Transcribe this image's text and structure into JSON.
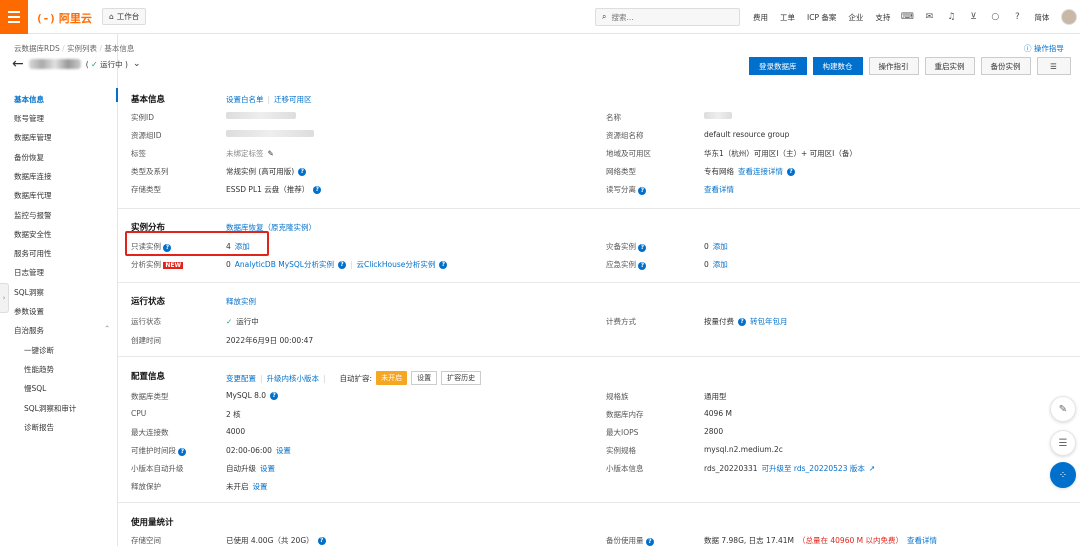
{
  "topbar": {
    "logo_mark": "(-)",
    "logo_text": "阿里云",
    "workbench": "工作台",
    "search_placeholder": "搜索...",
    "nav": [
      "费用",
      "工单",
      "ICP 备案",
      "企业",
      "支持"
    ],
    "lang": "简体"
  },
  "sidebar": {
    "items": [
      "基本信息",
      "账号管理",
      "数据库管理",
      "备份恢复",
      "数据库连接",
      "数据库代理",
      "监控与报警",
      "数据安全性",
      "服务可用性",
      "日志管理",
      "SQL洞察",
      "参数设置",
      "自治服务",
      "一键诊断",
      "性能趋势",
      "慢SQL",
      "SQL洞察和审计",
      "诊断报告"
    ]
  },
  "header": {
    "breadcrumb": [
      "云数据库RDS",
      "实例列表",
      "基本信息"
    ],
    "status": "运行中",
    "help": "操作指导"
  },
  "actions": {
    "login": "登录数据库",
    "build": "构建数仓",
    "guide": "操作指引",
    "restart": "重启实例",
    "backup": "备份实例"
  },
  "basic": {
    "title": "基本信息",
    "link_whitelist": "设置白名单",
    "link_migrate": "迁移可用区",
    "instance_id_label": "实例ID",
    "name_label": "名称",
    "rg_id_label": "资源组ID",
    "rg_name_label": "资源组名称",
    "rg_name_value": "default resource group",
    "tag_label": "标签",
    "tag_value": "未绑定标签",
    "region_label": "地域及可用区",
    "region_value": "华东1（杭州）可用区I（主）+ 可用区I（备）",
    "type_label": "类型及系列",
    "type_value": "常规实例 (高可用版)",
    "network_label": "网络类型",
    "network_value": "专有网络",
    "network_link": "查看连接详情",
    "storage_label": "存储类型",
    "storage_value": "ESSD PL1 云盘（推荐）",
    "rw_label": "读写分离",
    "rw_link": "查看详情"
  },
  "dist": {
    "title": "实例分布",
    "link": "数据库恢复（原克隆实例）",
    "ro_label": "只读实例",
    "ro_value": "4",
    "ro_add": "添加",
    "dr_label": "灾备实例",
    "dr_value": "0",
    "dr_add": "添加",
    "an_label": "分析实例",
    "an_tag": "NEW",
    "an_value": "0",
    "an_link1": "AnalyticDB MySQL分析实例",
    "an_link2": "云ClickHouse分析实例",
    "em_label": "应急实例",
    "em_value": "0",
    "em_add": "添加"
  },
  "run": {
    "title": "运行状态",
    "link": "释放实例",
    "status_label": "运行状态",
    "status_value": "运行中",
    "pay_label": "计费方式",
    "pay_value": "按量付费",
    "pay_link": "转包年包月",
    "created_label": "创建时间",
    "created_value": "2022年6月9日 00:00:47"
  },
  "config": {
    "title": "配置信息",
    "link_change": "变更配置",
    "link_upgrade": "升级内核小版本",
    "autoexp_label": "自动扩容:",
    "autoexp_status": "未开启",
    "autoexp_set": "设置",
    "autoexp_hist": "扩容历史",
    "db_label": "数据库类型",
    "db_value": "MySQL  8.0",
    "family_label": "规格族",
    "family_value": "通用型",
    "cpu_label": "CPU",
    "cpu_value": "2 核",
    "mem_label": "数据库内存",
    "mem_value": "4096 M",
    "conn_label": "最大连接数",
    "conn_value": "4000",
    "iops_label": "最大IOPS",
    "iops_value": "2800",
    "maint_label": "可维护时间段",
    "maint_value": "02:00-06:00",
    "maint_link": "设置",
    "spec_label": "实例规格",
    "spec_value": "mysql.n2.medium.2c",
    "minor_label": "小版本自动升级",
    "minor_value": "自动升级",
    "minor_link": "设置",
    "ver_label": "小版本信息",
    "ver_value": "rds_20220331",
    "ver_link": "可升级至 rds_20220523 版本",
    "release_label": "释放保护",
    "release_value": "未开启",
    "release_link": "设置"
  },
  "usage": {
    "title": "使用量统计",
    "space_label": "存储空间",
    "space_value": "已使用 4.00G（共 20G）",
    "backup_label": "备份使用量",
    "backup_value": "数据 7.98G, 日志 17.41M",
    "backup_free": "（总量在 40960 M 以内免费）",
    "backup_link": "查看详情"
  }
}
